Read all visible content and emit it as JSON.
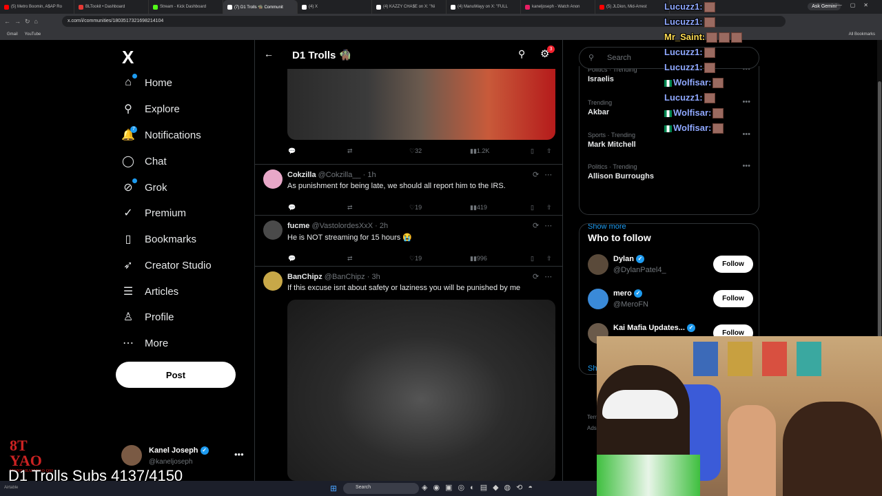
{
  "browser": {
    "tabs": [
      {
        "label": "(5) Metro Boomin, A$AP Ro",
        "color": "#ff0000"
      },
      {
        "label": "BLTookit • Dashboard",
        "color": "#e53935"
      },
      {
        "label": "Stream - Kick Dashboard",
        "color": "#53fc18"
      },
      {
        "label": "(7) D1 Trolls 🧌 Communit",
        "color": "#ffffff"
      },
      {
        "label": "(4) X",
        "color": "#ffffff"
      },
      {
        "label": "(4) KAZZY CHA$E on X: \"Ni",
        "color": "#ffffff"
      },
      {
        "label": "(4) ManuWayy on X: \"FULL",
        "color": "#ffffff"
      },
      {
        "label": "kaneljoseph - Watch Anon",
        "color": "#e91e63"
      },
      {
        "label": "(5) JLDion, Mid-Arrest",
        "color": "#ff0000"
      }
    ],
    "ask_gemini": "Ask Gemini",
    "url": "x.com/i/communities/1803517321698214104",
    "bookmarks": [
      "Gmail",
      "YouTube"
    ],
    "all_bookmarks": "All Bookmarks"
  },
  "sidebar": {
    "logo": "X",
    "items": [
      {
        "label": "Home",
        "icon": "home-icon",
        "glyph": "⌂"
      },
      {
        "label": "Explore",
        "icon": "search-icon",
        "glyph": "⚲"
      },
      {
        "label": "Notifications",
        "icon": "bell-icon",
        "glyph": "🔔"
      },
      {
        "label": "Chat",
        "icon": "chat-icon",
        "glyph": "◯"
      },
      {
        "label": "Grok",
        "icon": "grok-icon",
        "glyph": "⊘"
      },
      {
        "label": "Premium",
        "icon": "verified-icon",
        "glyph": "✓"
      },
      {
        "label": "Bookmarks",
        "icon": "bookmark-icon",
        "glyph": "▯"
      },
      {
        "label": "Creator Studio",
        "icon": "rocket-icon",
        "glyph": "➶"
      },
      {
        "label": "Articles",
        "icon": "articles-icon",
        "glyph": "☰"
      },
      {
        "label": "Profile",
        "icon": "person-icon",
        "glyph": "♙"
      },
      {
        "label": "More",
        "icon": "more-icon",
        "glyph": "⋯"
      }
    ],
    "notifications_badge": "7",
    "post_label": "Post",
    "account": {
      "name": "Kanel Joseph",
      "handle": "@kaneljoseph"
    }
  },
  "feed": {
    "title": "D1 Trolls 🧌",
    "settings_badge": "3",
    "first_post_stats": {
      "reply": "",
      "repost": "",
      "like": "32",
      "views": "1.2K"
    },
    "tweets": [
      {
        "name": "Cokzilla",
        "handle": "@Cokzilla__",
        "time": "1h",
        "text": "As punishment for being late, we should all report him to the IRS.",
        "likes": "19",
        "views": "419",
        "avatar": "#e8a8c8"
      },
      {
        "name": "fucme",
        "handle": "@VastolordesXxX",
        "time": "2h",
        "text": "He is NOT streaming for 15 hours 😭",
        "likes": "19",
        "views": "996",
        "avatar": "#4a4a4a"
      },
      {
        "name": "BanChipz",
        "handle": "@BanChipz",
        "time": "3h",
        "text": "If this excuse isnt about safety or laziness you will be punished by me",
        "likes": "",
        "views": "",
        "avatar": "#c8a848"
      }
    ]
  },
  "right": {
    "search_placeholder": "Search",
    "trends": [
      {
        "cat": "Politics · Trending",
        "name": "Israelis"
      },
      {
        "cat": "Trending",
        "name": "Akbar"
      },
      {
        "cat": "Sports · Trending",
        "name": "Mark Mitchell"
      },
      {
        "cat": "Politics · Trending",
        "name": "Allison Burroughs"
      }
    ],
    "show_more": "Show more",
    "who_to_follow": "Who to follow",
    "suggestions": [
      {
        "name": "Dylan",
        "handle": "@DylanPatel4_",
        "avatar": "#5a4a3a"
      },
      {
        "name": "mero",
        "handle": "@MeroFN",
        "avatar": "#3a8ad8"
      },
      {
        "name": "Kai Mafia Updates...",
        "handle": "",
        "avatar": "#6a5a4a"
      }
    ],
    "follow_label": "Follow",
    "show_partial": "Sh",
    "fine1": "Terr",
    "fine2": "Ads"
  },
  "chat": [
    {
      "user": "Lucuzz1:",
      "color": "#8fa8ff",
      "emotes": 1,
      "flag": false
    },
    {
      "user": "Lucuzz1:",
      "color": "#8fa8ff",
      "emotes": 1,
      "flag": false
    },
    {
      "user": "Mr_Saint:",
      "color": "#ffdd55",
      "emotes": 3,
      "flag": false
    },
    {
      "user": "Lucuzz1:",
      "color": "#8fa8ff",
      "emotes": 1,
      "flag": false
    },
    {
      "user": "Lucuzz1:",
      "color": "#8fa8ff",
      "emotes": 1,
      "flag": false
    },
    {
      "user": "Wolfisar:",
      "color": "#8fa8ff",
      "emotes": 1,
      "flag": true
    },
    {
      "user": "Lucuzz1:",
      "color": "#8fa8ff",
      "emotes": 1,
      "flag": false
    },
    {
      "user": "Wolfisar:",
      "color": "#8fa8ff",
      "emotes": 1,
      "flag": true
    },
    {
      "user": "Wolfisar:",
      "color": "#8fa8ff",
      "emotes": 1,
      "flag": true
    }
  ],
  "overlay": {
    "subs": "D1 Trolls Subs 4137/4150",
    "stamp_big": "8T YAO",
    "stamp_small": "MONTARAM YAO QSI"
  },
  "taskbar": {
    "search": "Search",
    "left": "Airtable"
  }
}
